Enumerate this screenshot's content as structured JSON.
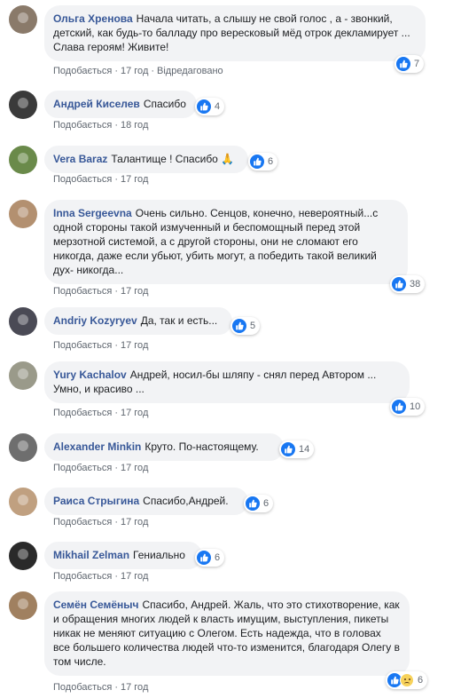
{
  "labels": {
    "like": "Подобається",
    "edited": "Відредаговано"
  },
  "colors": {
    "author": "#385898",
    "bubble": "#f2f3f5",
    "like": "#1877f2",
    "meta": "#606770"
  },
  "comments": [
    {
      "author": "Ольга Хренова",
      "text": "Начала читать, а слышу не свой голос , а - звонкий, детский, как будь-то балладу про вересковый мёд отрок декламирует ... Слава героям! Живите!",
      "time": "17 год",
      "edited": true,
      "reactions": [
        "like-icon"
      ],
      "count": "7"
    },
    {
      "author": "Андрей Киселев",
      "text": "Спасибо",
      "time": "18 год",
      "edited": false,
      "reactions": [
        "like-icon"
      ],
      "count": "4"
    },
    {
      "author": "Vera Baraz",
      "text": "Талантище ! Спасибо 🙏",
      "time": "17 год",
      "edited": false,
      "reactions": [
        "like-icon"
      ],
      "count": "6"
    },
    {
      "author": "Inna Sergeevna",
      "text": "Очень сильно. Сенцов, конечно, невероятный...с одной стороны такой измученный и беспомощный перед этой мерзотной системой, а с другой стороны, они не сломают его никогда, даже если убьют, убить могут, а победить такой великий дух- никогда...",
      "time": "17 год",
      "edited": false,
      "reactions": [
        "like-icon"
      ],
      "count": "38"
    },
    {
      "author": "Andriy Kozyryev",
      "text": "Да, так и есть...",
      "time": "17 год",
      "edited": false,
      "reactions": [
        "like-icon"
      ],
      "count": "5"
    },
    {
      "author": "Yury Kachalov",
      "text": "Андрей, носил-бы шляпу - снял перед Автором ... Умно, и красиво ...",
      "time": "17 год",
      "edited": false,
      "reactions": [
        "like-icon"
      ],
      "count": "10"
    },
    {
      "author": "Alexander Minkin",
      "text": "Круто. По-настоящему.",
      "time": "17 год",
      "edited": false,
      "reactions": [
        "like-icon"
      ],
      "count": "14"
    },
    {
      "author": "Раиса Стрыгина",
      "text": "Спасибо,Андрей.",
      "time": "17 год",
      "edited": false,
      "reactions": [
        "like-icon"
      ],
      "count": "6"
    },
    {
      "author": "Mikhail Zelman",
      "text": "Гениально",
      "time": "17 год",
      "edited": false,
      "reactions": [
        "like-icon"
      ],
      "count": "6"
    },
    {
      "author": "Семён Семёныч",
      "text": "Спасибо, Андрей. Жаль, что это стихотворение, как и обращения многих людей к власть имущим, выступления, пикеты никак не меняют ситуацию с Олегом. Есть надежда, что в головах все большего количества людей что-то изменится, благодаря Олегу в том числе.",
      "time": "17 год",
      "edited": false,
      "reactions": [
        "like-icon",
        "sad-icon"
      ],
      "count": "6"
    }
  ]
}
